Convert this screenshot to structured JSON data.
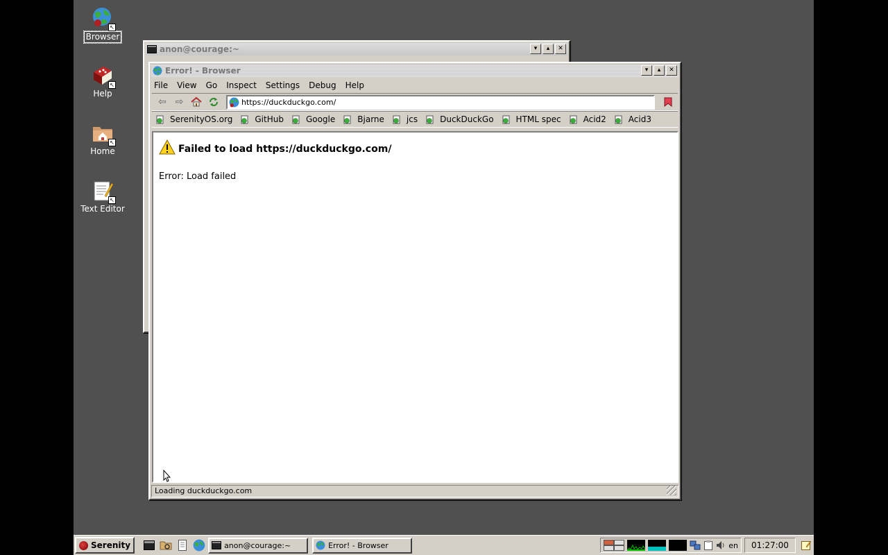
{
  "desktop": {
    "icons": [
      {
        "label": "Browser",
        "icon": "browser-globe-icon"
      },
      {
        "label": "Help",
        "icon": "help-book-icon"
      },
      {
        "label": "Home",
        "icon": "home-folder-icon"
      },
      {
        "label": "Text Editor",
        "icon": "text-editor-icon"
      }
    ]
  },
  "terminal_window": {
    "title": "anon@courage:~"
  },
  "browser_window": {
    "title": "Error! - Browser",
    "menu": [
      "File",
      "View",
      "Go",
      "Inspect",
      "Settings",
      "Debug",
      "Help"
    ],
    "url": "https://duckduckgo.com/",
    "bookmarks": [
      "SerenityOS.org",
      "GitHub",
      "Google",
      "Bjarne",
      "jcs",
      "DuckDuckGo",
      "HTML spec",
      "Acid2",
      "Acid3"
    ],
    "page": {
      "error_heading": "Failed to load https://duckduckgo.com/",
      "error_detail": "Error: Load failed"
    },
    "status": "Loading duckduckgo.com"
  },
  "taskbar": {
    "start_label": "Serenity",
    "tasks": [
      {
        "label": "anon@courage:~",
        "icon": "terminal-icon"
      },
      {
        "label": "Error! - Browser",
        "icon": "browser-globe-icon"
      }
    ],
    "keyboard_layout": "en",
    "clock": "01:27:00"
  },
  "colors": {
    "desktop": "#505050",
    "window_face": "#d4d0c8",
    "cpu_graph": "#00c000",
    "net_graph": "#00c0c0"
  }
}
